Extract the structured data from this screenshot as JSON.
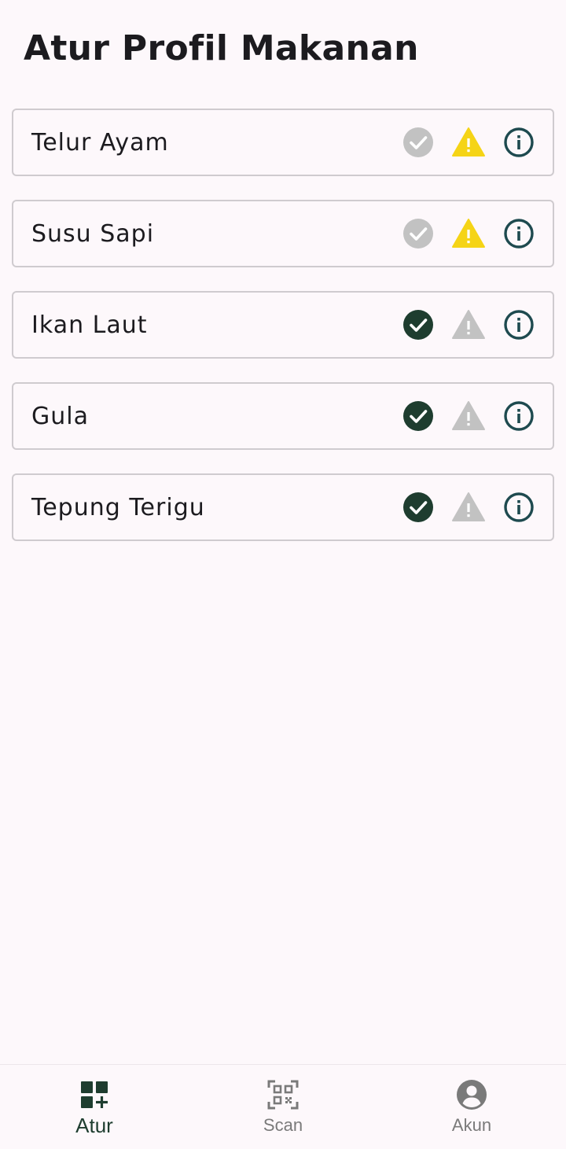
{
  "page": {
    "title": "Atur Profil Makanan"
  },
  "colors": {
    "background": "#fdf8fb",
    "dark_green": "#1e3d2f",
    "teal_outline": "#1e4a4f",
    "warning_yellow": "#f5d416",
    "inactive_gray": "#c2c2c2"
  },
  "items": [
    {
      "label": "Telur Ayam",
      "check_state": "inactive",
      "warning_state": "active"
    },
    {
      "label": "Susu Sapi",
      "check_state": "inactive",
      "warning_state": "active"
    },
    {
      "label": "Ikan Laut",
      "check_state": "active",
      "warning_state": "inactive"
    },
    {
      "label": "Gula",
      "check_state": "active",
      "warning_state": "inactive"
    },
    {
      "label": "Tepung Terigu",
      "check_state": "active",
      "warning_state": "inactive"
    }
  ],
  "icons": {
    "check": "check-circle-icon",
    "warning": "warning-triangle-icon",
    "info": "info-circle-icon"
  },
  "nav": {
    "items": [
      {
        "label": "Atur",
        "icon": "dashboard-add-icon",
        "active": true
      },
      {
        "label": "Scan",
        "icon": "qr-scan-icon",
        "active": false
      },
      {
        "label": "Akun",
        "icon": "account-circle-icon",
        "active": false
      }
    ]
  }
}
